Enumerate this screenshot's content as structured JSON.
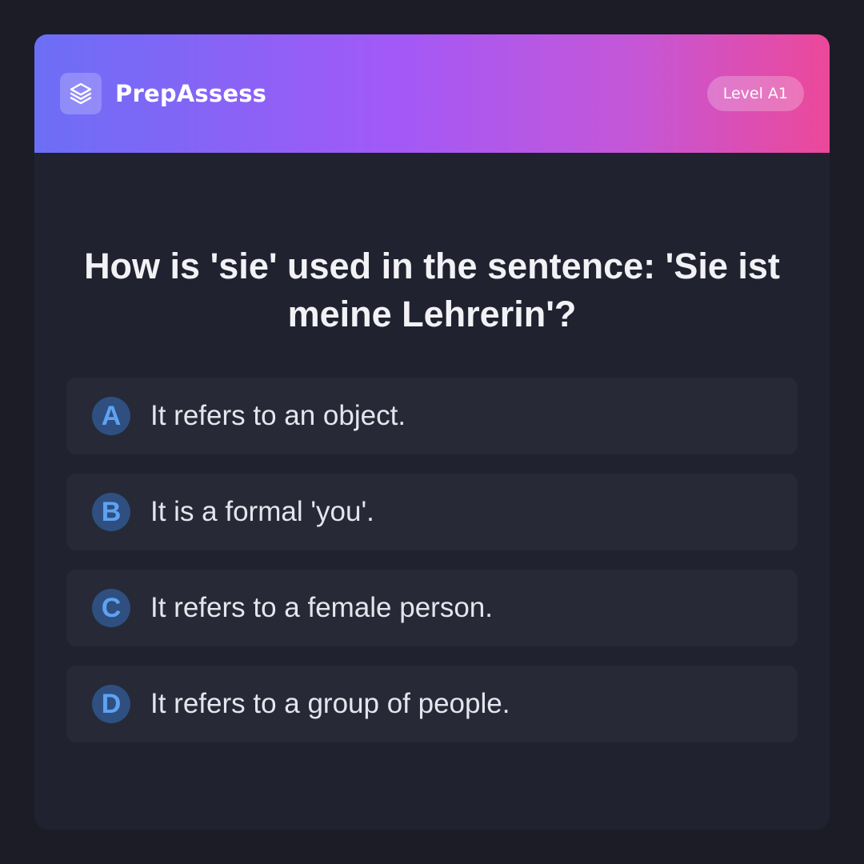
{
  "header": {
    "brand_name": "PrepAssess",
    "logo_icon": "layers-icon",
    "level_badge": "Level A1"
  },
  "question": {
    "text": "How is 'sie' used in the sentence: 'Sie ist meine Lehrerin'?"
  },
  "options": [
    {
      "letter": "A",
      "text": "It refers to an object."
    },
    {
      "letter": "B",
      "text": "It is a formal 'you'."
    },
    {
      "letter": "C",
      "text": "It refers to a female person."
    },
    {
      "letter": "D",
      "text": "It refers to a group of people."
    }
  ],
  "colors": {
    "gradient_start": "#6c6ef6",
    "gradient_mid": "#a259f7",
    "gradient_end": "#ec4899",
    "card_background": "#20222f",
    "option_background": "#272936",
    "letter_circle": "#2f4f80",
    "letter_text": "#5ea3f2"
  }
}
